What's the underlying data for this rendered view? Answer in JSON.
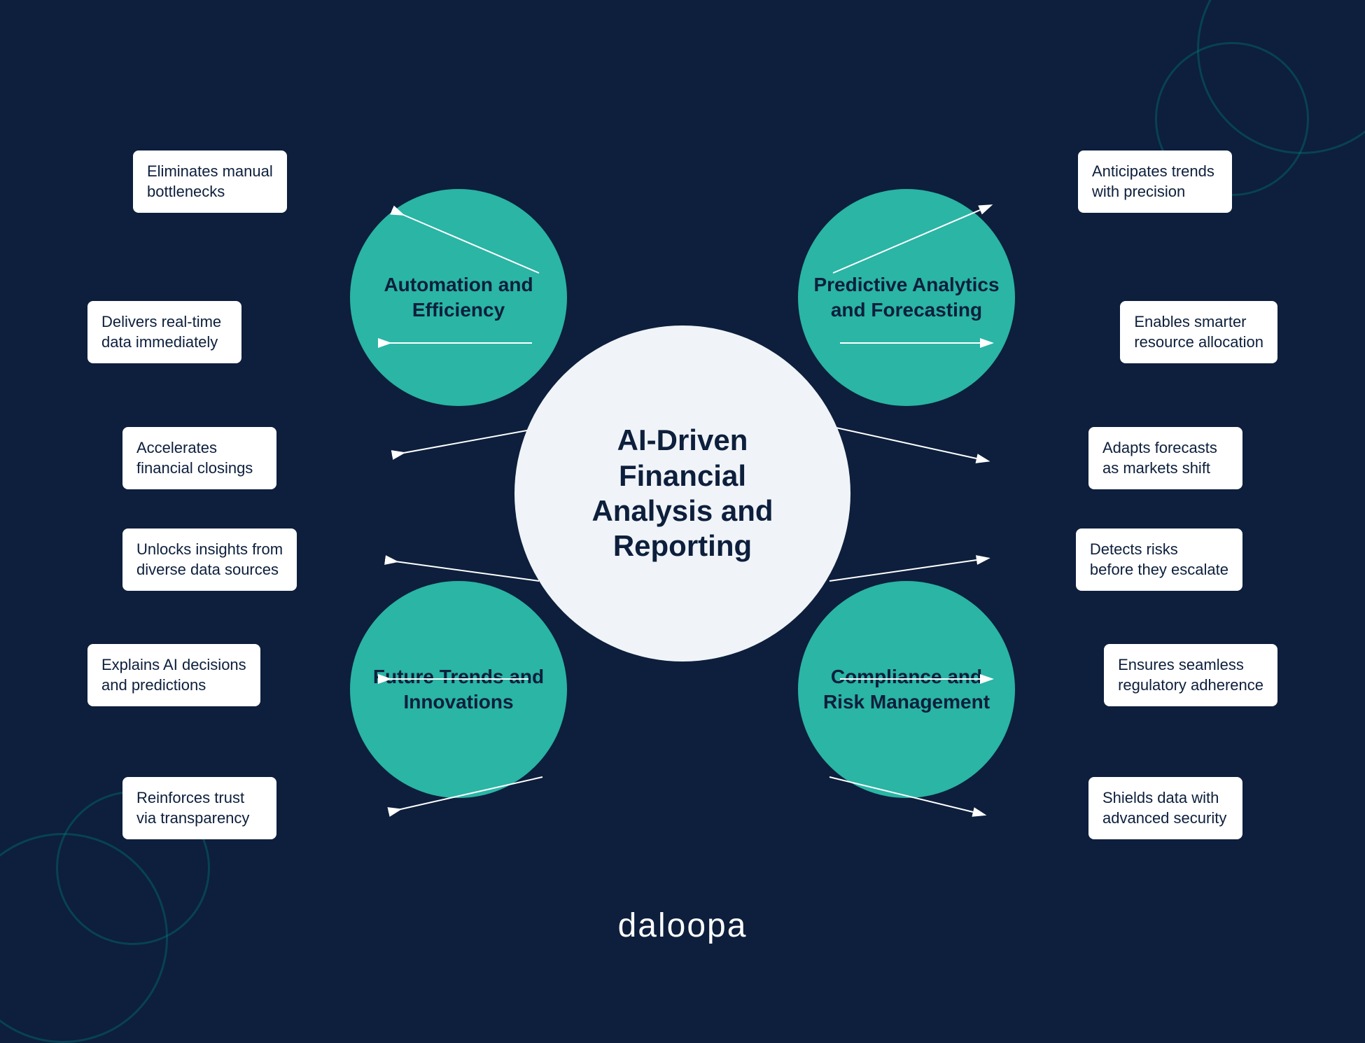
{
  "diagram": {
    "center": {
      "title": "AI-Driven\nFinancial\nAnalysis and\nReporting"
    },
    "satellites": {
      "top_left": {
        "label": "Automation and\nEfficiency",
        "items": [
          "Eliminates manual\nbottlenecks",
          "Delivers real-time\ndata immediately",
          "Accelerates\nfinancial closings"
        ]
      },
      "top_right": {
        "label": "Predictive Analytics\nand Forecasting",
        "items": [
          "Anticipates trends\nwith precision",
          "Enables smarter\nresource allocation",
          "Adapts forecasts\nas markets shift"
        ]
      },
      "bottom_left": {
        "label": "Future Trends and\nInnovations",
        "items": [
          "Unlocks insights from\ndiverse data sources",
          "Explains AI decisions\nand predictions",
          "Reinforces trust\nvia transparency"
        ]
      },
      "bottom_right": {
        "label": "Compliance and\nRisk Management",
        "items": [
          "Detects risks\nbefore they escalate",
          "Ensures seamless\nregulatory adherence",
          "Shields data with\nadvanced security"
        ]
      }
    },
    "logo": "daloopa",
    "colors": {
      "background": "#0d1f3c",
      "satellite": "#2ab5a5",
      "center": "#e8f0f5",
      "text_dark": "#0d1f3c",
      "text_white": "#ffffff",
      "box_bg": "#ffffff",
      "arrow": "#ffffff",
      "deco": "#1a6060"
    }
  }
}
